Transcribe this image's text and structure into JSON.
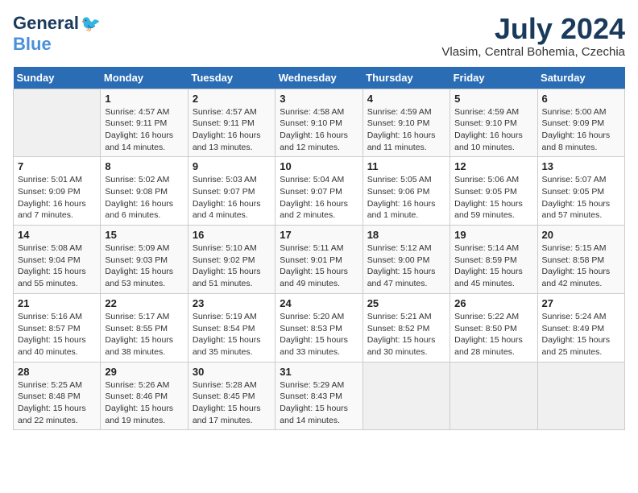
{
  "header": {
    "logo_line1": "General",
    "logo_line2": "Blue",
    "month_title": "July 2024",
    "location": "Vlasim, Central Bohemia, Czechia"
  },
  "calendar": {
    "days_of_week": [
      "Sunday",
      "Monday",
      "Tuesday",
      "Wednesday",
      "Thursday",
      "Friday",
      "Saturday"
    ],
    "weeks": [
      [
        {
          "day": "",
          "info": ""
        },
        {
          "day": "1",
          "info": "Sunrise: 4:57 AM\nSunset: 9:11 PM\nDaylight: 16 hours\nand 14 minutes."
        },
        {
          "day": "2",
          "info": "Sunrise: 4:57 AM\nSunset: 9:11 PM\nDaylight: 16 hours\nand 13 minutes."
        },
        {
          "day": "3",
          "info": "Sunrise: 4:58 AM\nSunset: 9:10 PM\nDaylight: 16 hours\nand 12 minutes."
        },
        {
          "day": "4",
          "info": "Sunrise: 4:59 AM\nSunset: 9:10 PM\nDaylight: 16 hours\nand 11 minutes."
        },
        {
          "day": "5",
          "info": "Sunrise: 4:59 AM\nSunset: 9:10 PM\nDaylight: 16 hours\nand 10 minutes."
        },
        {
          "day": "6",
          "info": "Sunrise: 5:00 AM\nSunset: 9:09 PM\nDaylight: 16 hours\nand 8 minutes."
        }
      ],
      [
        {
          "day": "7",
          "info": "Sunrise: 5:01 AM\nSunset: 9:09 PM\nDaylight: 16 hours\nand 7 minutes."
        },
        {
          "day": "8",
          "info": "Sunrise: 5:02 AM\nSunset: 9:08 PM\nDaylight: 16 hours\nand 6 minutes."
        },
        {
          "day": "9",
          "info": "Sunrise: 5:03 AM\nSunset: 9:07 PM\nDaylight: 16 hours\nand 4 minutes."
        },
        {
          "day": "10",
          "info": "Sunrise: 5:04 AM\nSunset: 9:07 PM\nDaylight: 16 hours\nand 2 minutes."
        },
        {
          "day": "11",
          "info": "Sunrise: 5:05 AM\nSunset: 9:06 PM\nDaylight: 16 hours\nand 1 minute."
        },
        {
          "day": "12",
          "info": "Sunrise: 5:06 AM\nSunset: 9:05 PM\nDaylight: 15 hours\nand 59 minutes."
        },
        {
          "day": "13",
          "info": "Sunrise: 5:07 AM\nSunset: 9:05 PM\nDaylight: 15 hours\nand 57 minutes."
        }
      ],
      [
        {
          "day": "14",
          "info": "Sunrise: 5:08 AM\nSunset: 9:04 PM\nDaylight: 15 hours\nand 55 minutes."
        },
        {
          "day": "15",
          "info": "Sunrise: 5:09 AM\nSunset: 9:03 PM\nDaylight: 15 hours\nand 53 minutes."
        },
        {
          "day": "16",
          "info": "Sunrise: 5:10 AM\nSunset: 9:02 PM\nDaylight: 15 hours\nand 51 minutes."
        },
        {
          "day": "17",
          "info": "Sunrise: 5:11 AM\nSunset: 9:01 PM\nDaylight: 15 hours\nand 49 minutes."
        },
        {
          "day": "18",
          "info": "Sunrise: 5:12 AM\nSunset: 9:00 PM\nDaylight: 15 hours\nand 47 minutes."
        },
        {
          "day": "19",
          "info": "Sunrise: 5:14 AM\nSunset: 8:59 PM\nDaylight: 15 hours\nand 45 minutes."
        },
        {
          "day": "20",
          "info": "Sunrise: 5:15 AM\nSunset: 8:58 PM\nDaylight: 15 hours\nand 42 minutes."
        }
      ],
      [
        {
          "day": "21",
          "info": "Sunrise: 5:16 AM\nSunset: 8:57 PM\nDaylight: 15 hours\nand 40 minutes."
        },
        {
          "day": "22",
          "info": "Sunrise: 5:17 AM\nSunset: 8:55 PM\nDaylight: 15 hours\nand 38 minutes."
        },
        {
          "day": "23",
          "info": "Sunrise: 5:19 AM\nSunset: 8:54 PM\nDaylight: 15 hours\nand 35 minutes."
        },
        {
          "day": "24",
          "info": "Sunrise: 5:20 AM\nSunset: 8:53 PM\nDaylight: 15 hours\nand 33 minutes."
        },
        {
          "day": "25",
          "info": "Sunrise: 5:21 AM\nSunset: 8:52 PM\nDaylight: 15 hours\nand 30 minutes."
        },
        {
          "day": "26",
          "info": "Sunrise: 5:22 AM\nSunset: 8:50 PM\nDaylight: 15 hours\nand 28 minutes."
        },
        {
          "day": "27",
          "info": "Sunrise: 5:24 AM\nSunset: 8:49 PM\nDaylight: 15 hours\nand 25 minutes."
        }
      ],
      [
        {
          "day": "28",
          "info": "Sunrise: 5:25 AM\nSunset: 8:48 PM\nDaylight: 15 hours\nand 22 minutes."
        },
        {
          "day": "29",
          "info": "Sunrise: 5:26 AM\nSunset: 8:46 PM\nDaylight: 15 hours\nand 19 minutes."
        },
        {
          "day": "30",
          "info": "Sunrise: 5:28 AM\nSunset: 8:45 PM\nDaylight: 15 hours\nand 17 minutes."
        },
        {
          "day": "31",
          "info": "Sunrise: 5:29 AM\nSunset: 8:43 PM\nDaylight: 15 hours\nand 14 minutes."
        },
        {
          "day": "",
          "info": ""
        },
        {
          "day": "",
          "info": ""
        },
        {
          "day": "",
          "info": ""
        }
      ]
    ]
  }
}
